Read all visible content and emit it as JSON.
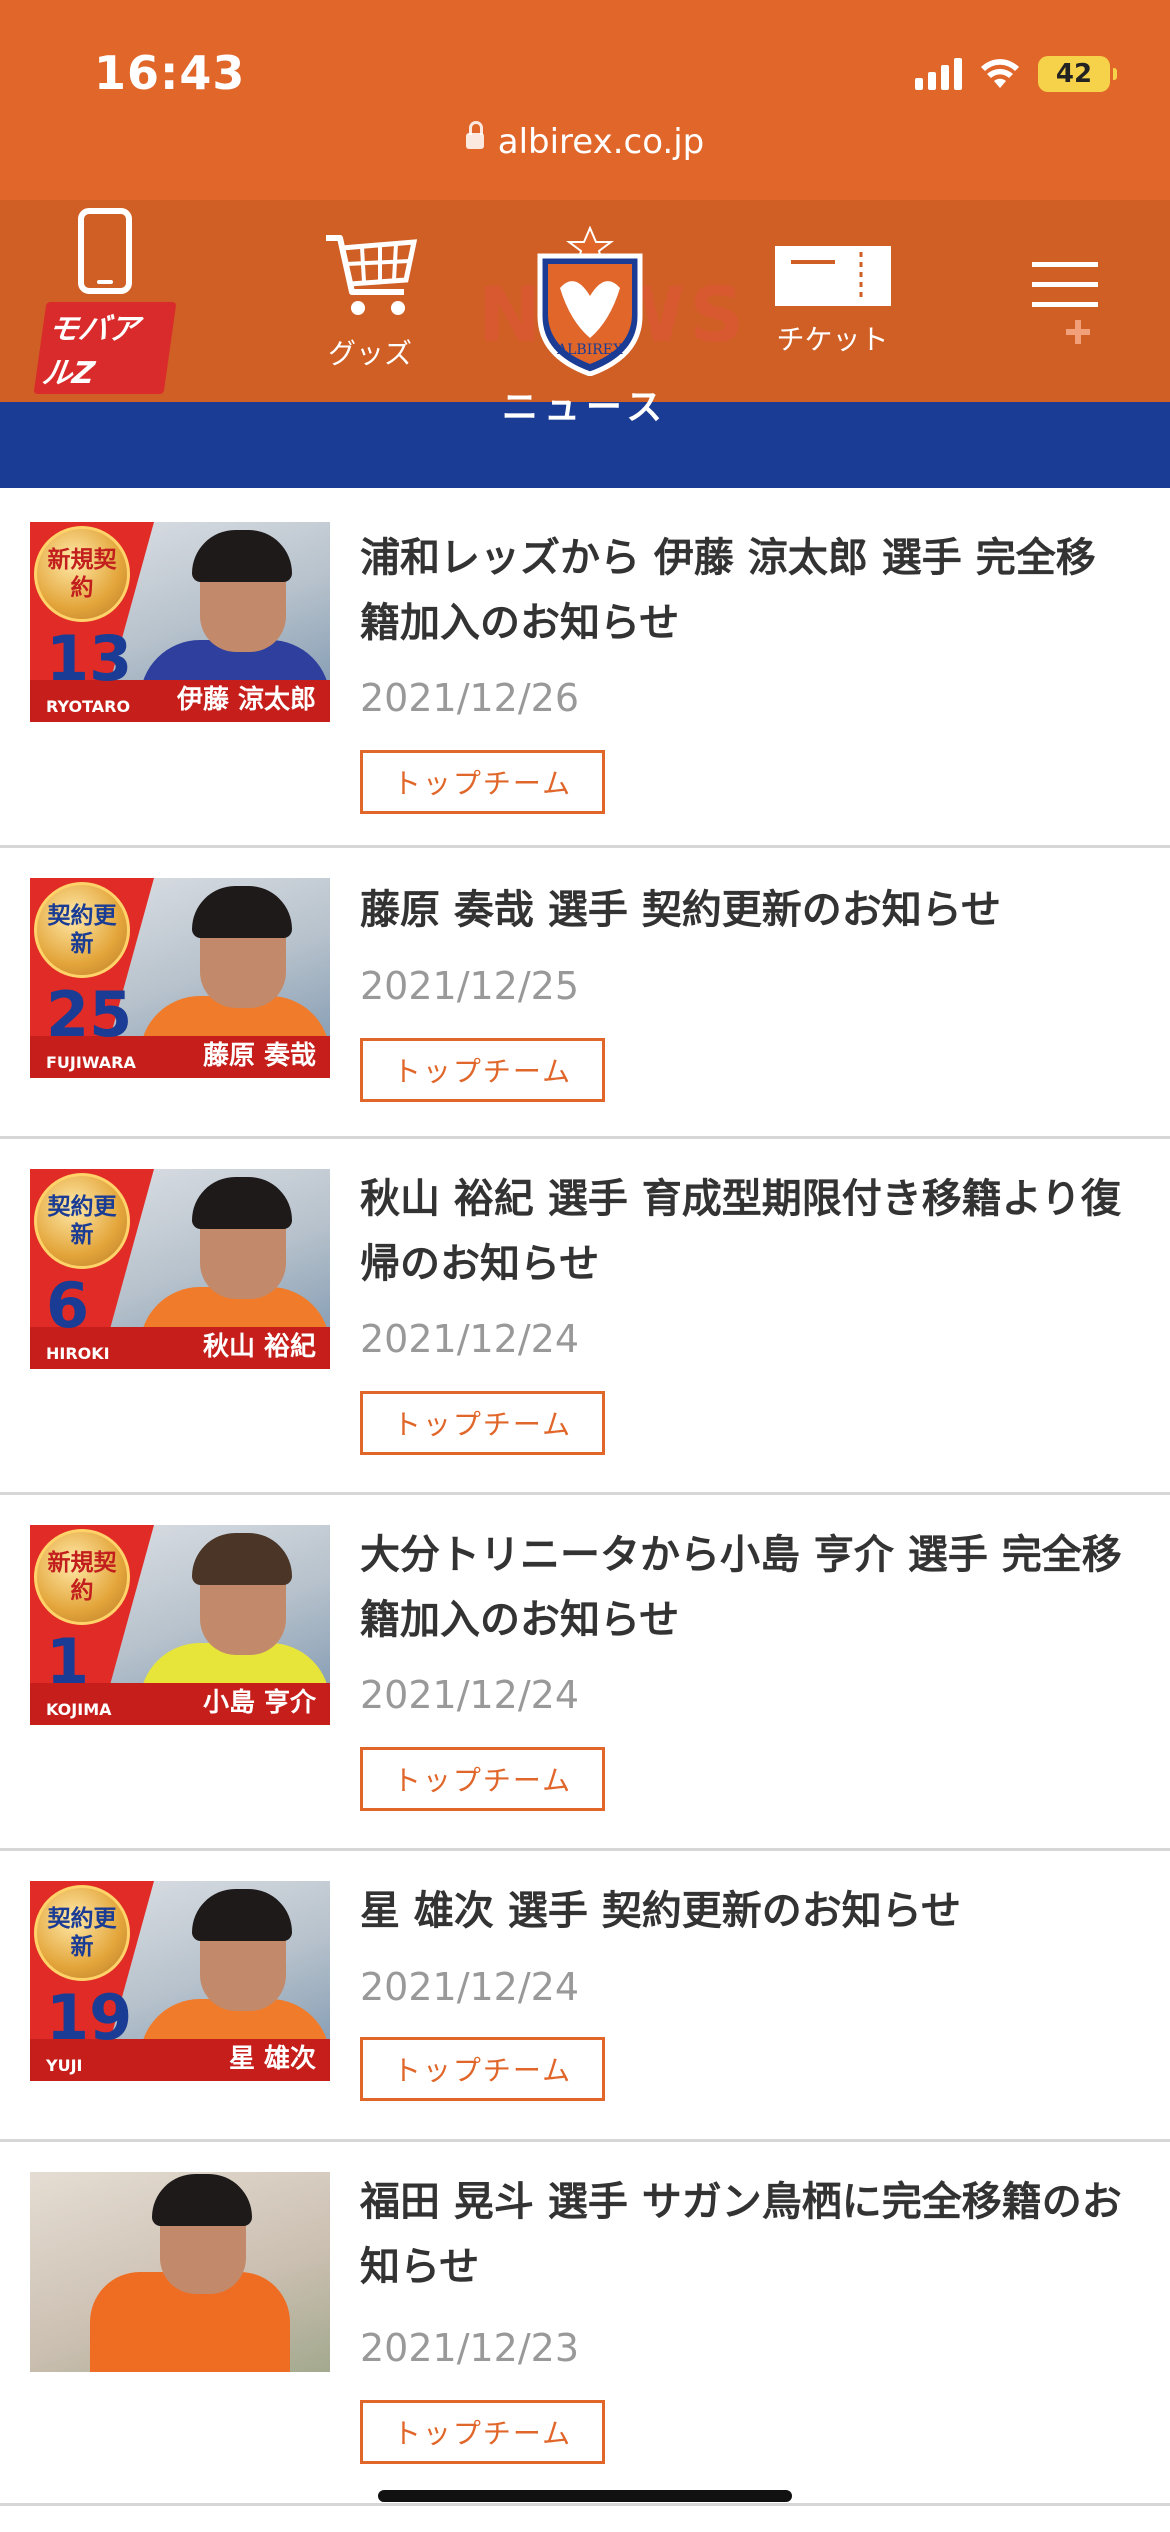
{
  "status_bar": {
    "time": "16:43",
    "battery": "42",
    "battery_color": "#f6d24a"
  },
  "browser": {
    "url": "albirex.co.jp"
  },
  "nav": {
    "items": [
      {
        "label": "モバアルZ",
        "icon": "smartphone-icon"
      },
      {
        "label": "グッズ",
        "icon": "cart-icon"
      },
      {
        "label": "",
        "icon": "club-crest-logo"
      },
      {
        "label": "チケット",
        "icon": "ticket-icon"
      },
      {
        "label": "",
        "icon": "hamburger-menu-icon"
      }
    ],
    "watermark": "NEWS",
    "section_title": "ニュース"
  },
  "colors": {
    "brand_orange": "#e0662a",
    "nav_orange": "#cf5f25",
    "navy": "#1b3c94",
    "badge_red": "#e12b26"
  },
  "news": [
    {
      "title": "浦和レッズから 伊藤 涼太郎 選手 完全移籍加入のお知らせ",
      "date": "2021/12/26",
      "tag": "トップチーム",
      "thumb": {
        "badge": "新規契約",
        "number": "13",
        "roman": "RYOTARO",
        "player": "伊藤 涼太郎"
      }
    },
    {
      "title": "藤原 奏哉 選手 契約更新のお知らせ",
      "date": "2021/12/25",
      "tag": "トップチーム",
      "thumb": {
        "badge": "契約更新",
        "number": "25",
        "roman": "FUJIWARA",
        "player": "藤原 奏哉"
      }
    },
    {
      "title": "秋山 裕紀 選手 育成型期限付き移籍より復帰のお知らせ",
      "date": "2021/12/24",
      "tag": "トップチーム",
      "thumb": {
        "badge": "契約更新",
        "number": "6",
        "roman": "HIROKI",
        "player": "秋山 裕紀"
      }
    },
    {
      "title": "大分トリニータから小島 亨介 選手 完全移籍加入のお知らせ",
      "date": "2021/12/24",
      "tag": "トップチーム",
      "thumb": {
        "badge": "新規契約",
        "number": "1",
        "roman": "KOJIMA",
        "player": "小島 亨介"
      }
    },
    {
      "title": "星 雄次 選手 契約更新のお知らせ",
      "date": "2021/12/24",
      "tag": "トップチーム",
      "thumb": {
        "badge": "契約更新",
        "number": "19",
        "roman": "YUJI",
        "player": "星 雄次"
      }
    },
    {
      "title": "福田 晃斗 選手 サガン鳥栖に完全移籍のお知らせ",
      "date": "2021/12/23",
      "tag": "トップチーム",
      "thumb": {
        "badge": "",
        "number": "",
        "roman": "",
        "player": ""
      }
    }
  ]
}
